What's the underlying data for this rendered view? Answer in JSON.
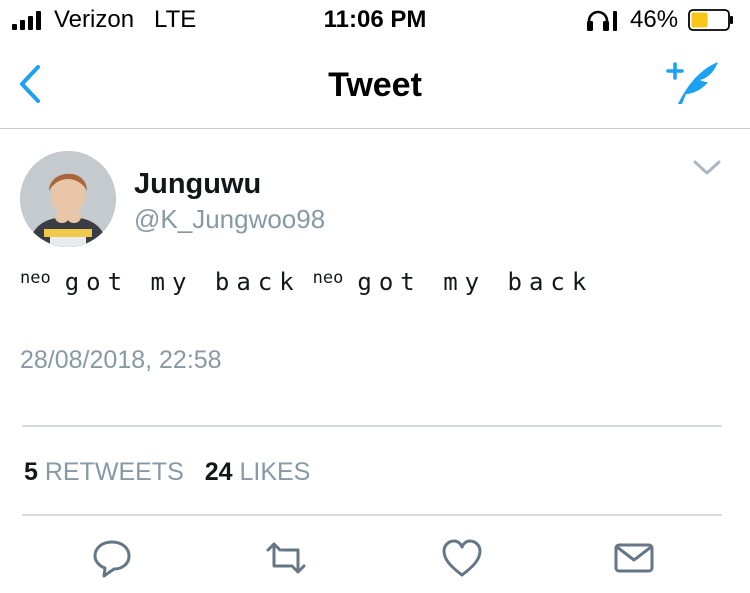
{
  "status_bar": {
    "carrier": "Verizon",
    "network": "LTE",
    "time": "11:06 PM",
    "battery_percent": "46%",
    "battery_level": 0.46,
    "battery_color": "#f5c518",
    "icons": [
      "signal-bars-icon",
      "headphones-icon",
      "battery-icon"
    ]
  },
  "nav": {
    "title": "Tweet",
    "accent_color": "#1da1f2",
    "icons": [
      "back-chevron-icon",
      "compose-tweet-icon"
    ]
  },
  "tweet": {
    "author": {
      "display_name": "Junguwu",
      "handle": "@K_Jungwoo98"
    },
    "text": {
      "prefix_1": "neo",
      "words_1": "got my back",
      "prefix_2": "neo",
      "words_2": "got my back"
    },
    "timestamp": "28/08/2018, 22:58",
    "stats": {
      "retweets_count": "5",
      "retweets_label": "RETWEETS",
      "likes_count": "24",
      "likes_label": "LIKES"
    },
    "actions": [
      "reply-icon",
      "retweet-icon",
      "like-icon",
      "direct-message-icon"
    ]
  }
}
